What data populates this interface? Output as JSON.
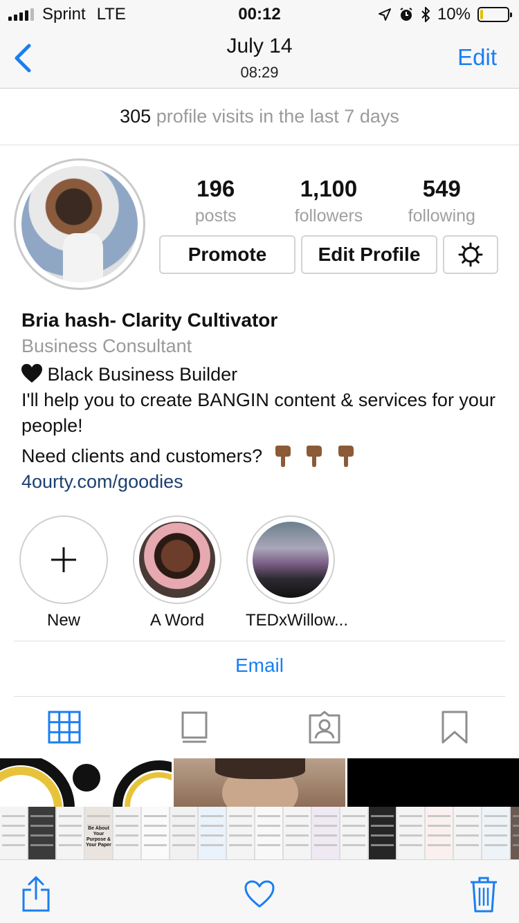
{
  "status_bar": {
    "carrier": "Sprint",
    "network": "LTE",
    "time": "00:12",
    "battery": "10%",
    "battery_level": 0.1
  },
  "nav": {
    "title": "July 14",
    "subtitle": "08:29",
    "edit_label": "Edit"
  },
  "visits": {
    "count": "305",
    "text": "profile visits in the last 7 days"
  },
  "stats": [
    {
      "value": "196",
      "label": "posts"
    },
    {
      "value": "1,100",
      "label": "followers"
    },
    {
      "value": "549",
      "label": "following"
    }
  ],
  "buttons": {
    "promote": "Promote",
    "edit_profile": "Edit Profile"
  },
  "bio": {
    "name": "Bria hash- Clarity Cultivator",
    "category": "Business Consultant",
    "line1": "Black Business Builder",
    "line2": "I'll help you to create BANGIN content & services for your people!",
    "line3": "Need clients and customers?",
    "link": "4ourty.com/goodies"
  },
  "highlights": [
    {
      "label": "New"
    },
    {
      "label": "A Word"
    },
    {
      "label": "TEDxWillow..."
    }
  ],
  "contact": {
    "email_label": "Email"
  },
  "grid_thumb_text": "Be About Your Purpose & Your Paper",
  "colors": {
    "accent": "#1a7ef2",
    "link": "#1c3f70",
    "muted": "#9a9a9a"
  }
}
